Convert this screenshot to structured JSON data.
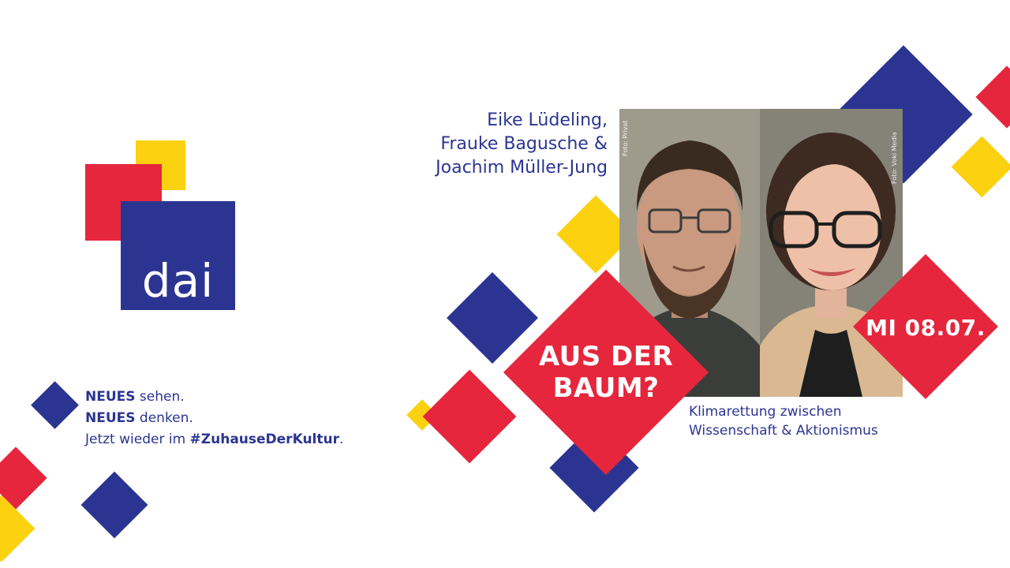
{
  "colors": {
    "blue": "#2b3591",
    "red": "#e5263c",
    "yellow": "#fcd10f",
    "text_blue": "#2b3591"
  },
  "logo": {
    "text": "dai"
  },
  "speakers": {
    "line1": "Eike Lüdeling,",
    "line2": "Frauke Bagusche &",
    "line3": "Joachim Müller-Jung"
  },
  "slogan": {
    "line1_bold": "NEUES",
    "line1_rest": " sehen.",
    "line2_bold": "NEUES",
    "line2_rest": " denken.",
    "line3_start": "Jetzt wieder im ",
    "line3_bold": "#ZuhauseDerKultur",
    "line3_end": "."
  },
  "title": {
    "line1": "AUS DER",
    "line2": "BAUM?"
  },
  "date": "MI 08.07.",
  "subtitle": {
    "line1": "Klimarettung zwischen",
    "line2": "Wissenschaft & Aktionismus"
  },
  "photo_credits": {
    "left": "Foto: Privat",
    "right": "Foto: Voki Media"
  }
}
